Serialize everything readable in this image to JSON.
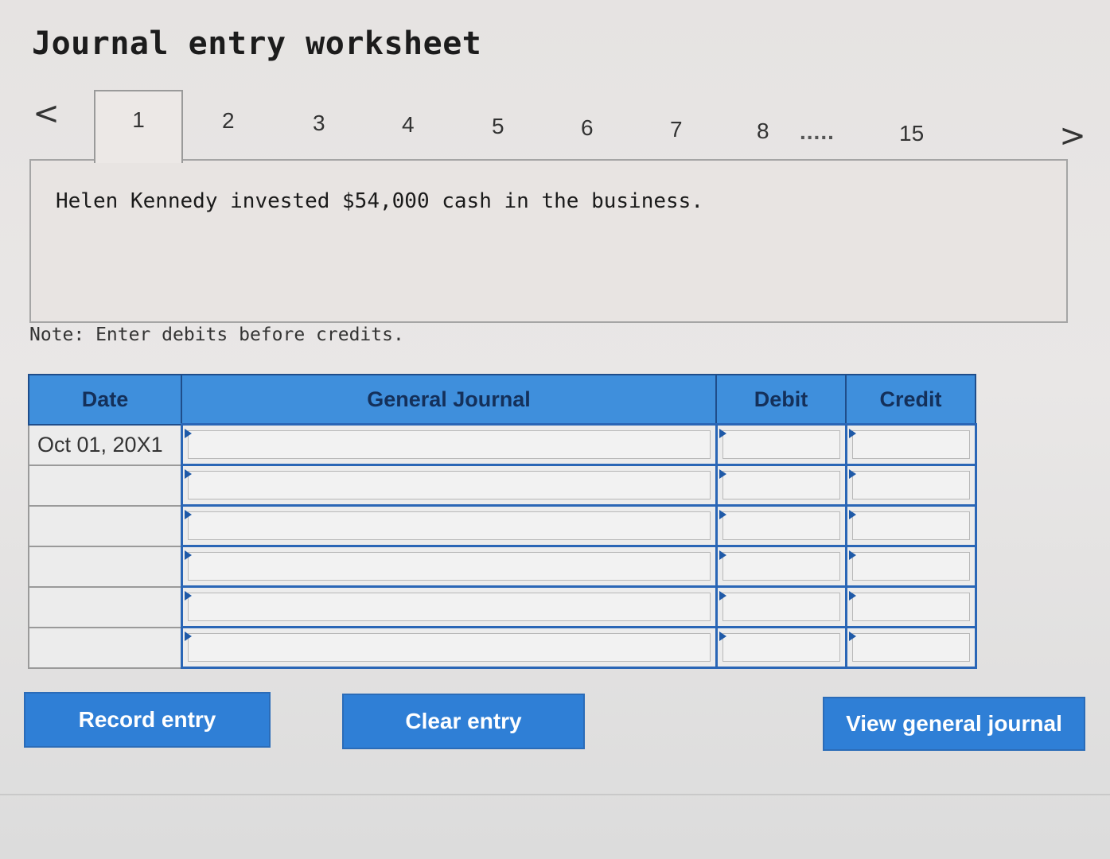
{
  "title": "Journal entry worksheet",
  "pagination": {
    "prev_icon": "chevron-left-icon",
    "next_icon": "chevron-right-icon",
    "prev_glyph": "<",
    "next_glyph": ">",
    "active": "1",
    "tabs": [
      "2",
      "3",
      "4",
      "5",
      "6",
      "7",
      "8",
      "15"
    ],
    "ellipsis": "....."
  },
  "question": "Helen Kennedy invested $54,000 cash in the business.",
  "note": "Note: Enter debits before credits.",
  "table": {
    "headers": {
      "date": "Date",
      "account": "General Journal",
      "debit": "Debit",
      "credit": "Credit"
    },
    "rows": [
      {
        "date": "Oct 01, 20X1",
        "account": "",
        "debit": "",
        "credit": ""
      },
      {
        "date": "",
        "account": "",
        "debit": "",
        "credit": ""
      },
      {
        "date": "",
        "account": "",
        "debit": "",
        "credit": ""
      },
      {
        "date": "",
        "account": "",
        "debit": "",
        "credit": ""
      },
      {
        "date": "",
        "account": "",
        "debit": "",
        "credit": ""
      },
      {
        "date": "",
        "account": "",
        "debit": "",
        "credit": ""
      }
    ]
  },
  "buttons": {
    "record": "Record entry",
    "clear": "Clear entry",
    "view": "View general journal"
  },
  "colors": {
    "accent": "#2f7fd6",
    "header": "#3f8fdc",
    "grid": "#2a66b6"
  }
}
